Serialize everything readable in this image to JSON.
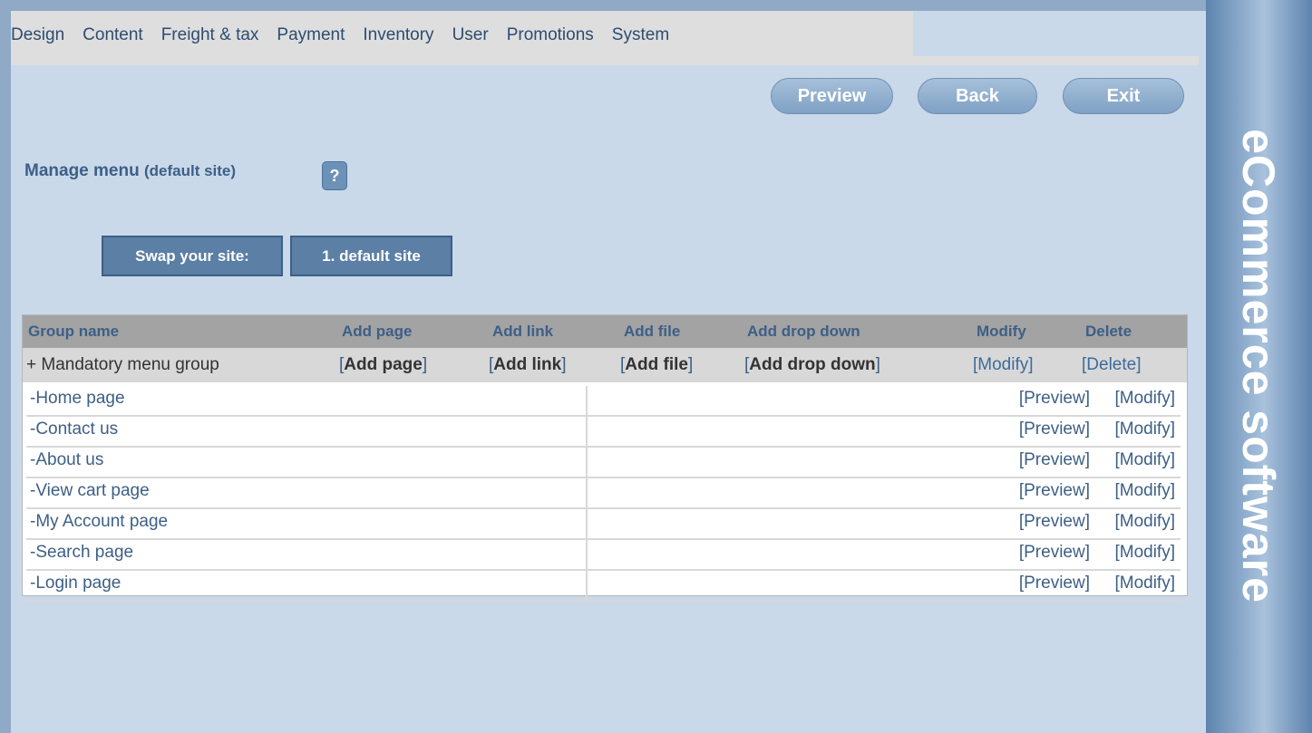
{
  "nav": {
    "items": [
      "Design",
      "Content",
      "Freight & tax",
      "Payment",
      "Inventory",
      "User",
      "Promotions",
      "System"
    ]
  },
  "actions": {
    "preview": "Preview",
    "back": "Back",
    "exit": "Exit"
  },
  "brand": "eCommerce software",
  "page": {
    "title": "Manage menu",
    "subtitle": "(default site)",
    "help": "?"
  },
  "site_switch": {
    "label": "Swap your site:",
    "value": "1. default site"
  },
  "table": {
    "headers": {
      "group_name": "Group name",
      "add_page": "Add page",
      "add_link": "Add link",
      "add_file": "Add file",
      "add_drop_down": "Add drop down",
      "modify": "Modify",
      "delete": "Delete"
    },
    "group": {
      "name": "+ Mandatory menu group",
      "add_page": "Add page",
      "add_link": "Add link",
      "add_file": "Add file",
      "add_drop_down": "Add drop down",
      "modify": "[Modify]",
      "delete": "[Delete]"
    },
    "row_preview": "[Preview]",
    "row_modify": "[Modify]",
    "rows": [
      {
        "name": "-Home page"
      },
      {
        "name": "-Contact us"
      },
      {
        "name": "-About us"
      },
      {
        "name": "-View cart page"
      },
      {
        "name": "-My Account page"
      },
      {
        "name": "-Search page"
      },
      {
        "name": "-Login page"
      }
    ]
  },
  "colors": {
    "background": "#c9d9ea",
    "accent": "#3d5f86",
    "button": "#5b7fa5"
  }
}
